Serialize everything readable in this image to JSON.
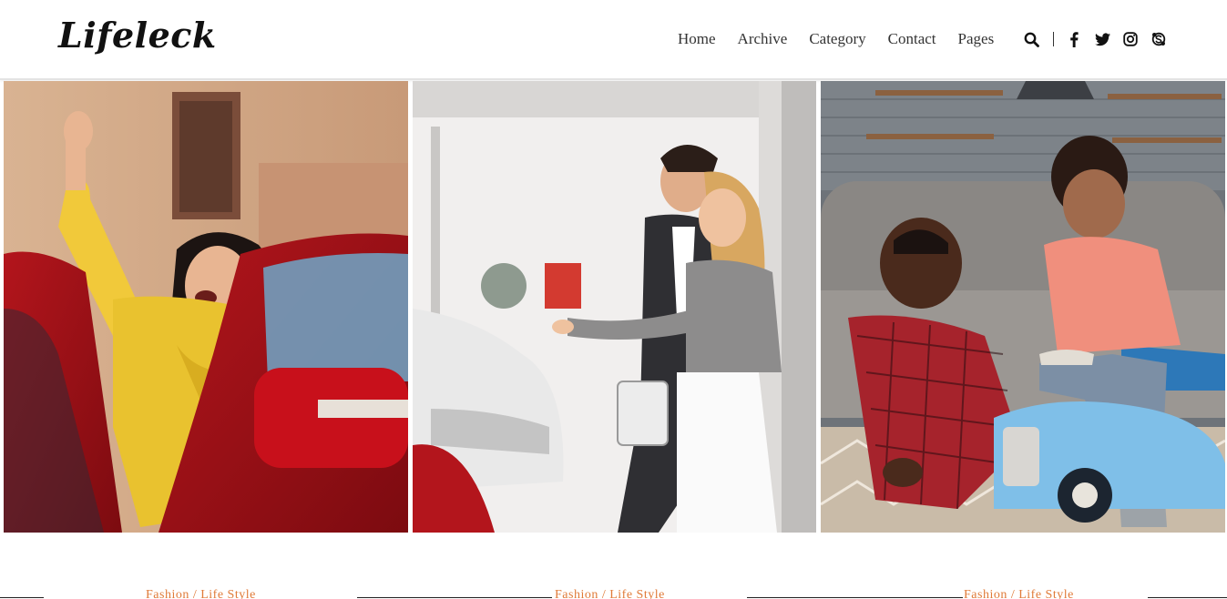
{
  "brand": {
    "logo_text": "Lifeleck"
  },
  "nav": {
    "items": [
      {
        "label": "Home"
      },
      {
        "label": "Archive"
      },
      {
        "label": "Category"
      },
      {
        "label": "Contact"
      },
      {
        "label": "Pages"
      }
    ]
  },
  "header_icons": {
    "search": "search-icon",
    "social": [
      "facebook-icon",
      "twitter-icon",
      "instagram-icon",
      "skype-icon"
    ]
  },
  "gallery": {
    "photos": [
      {
        "subject": "woman-yellow-sweater-red-car"
      },
      {
        "subject": "couple-car-showroom"
      },
      {
        "subject": "father-son-toy-car"
      }
    ]
  },
  "posts": {
    "category_labels": [
      "Fashion / Life Style",
      "Fashion / Life Style",
      "Fashion / Life Style"
    ]
  },
  "colors": {
    "accent": "#e07b39",
    "text": "#222222"
  }
}
